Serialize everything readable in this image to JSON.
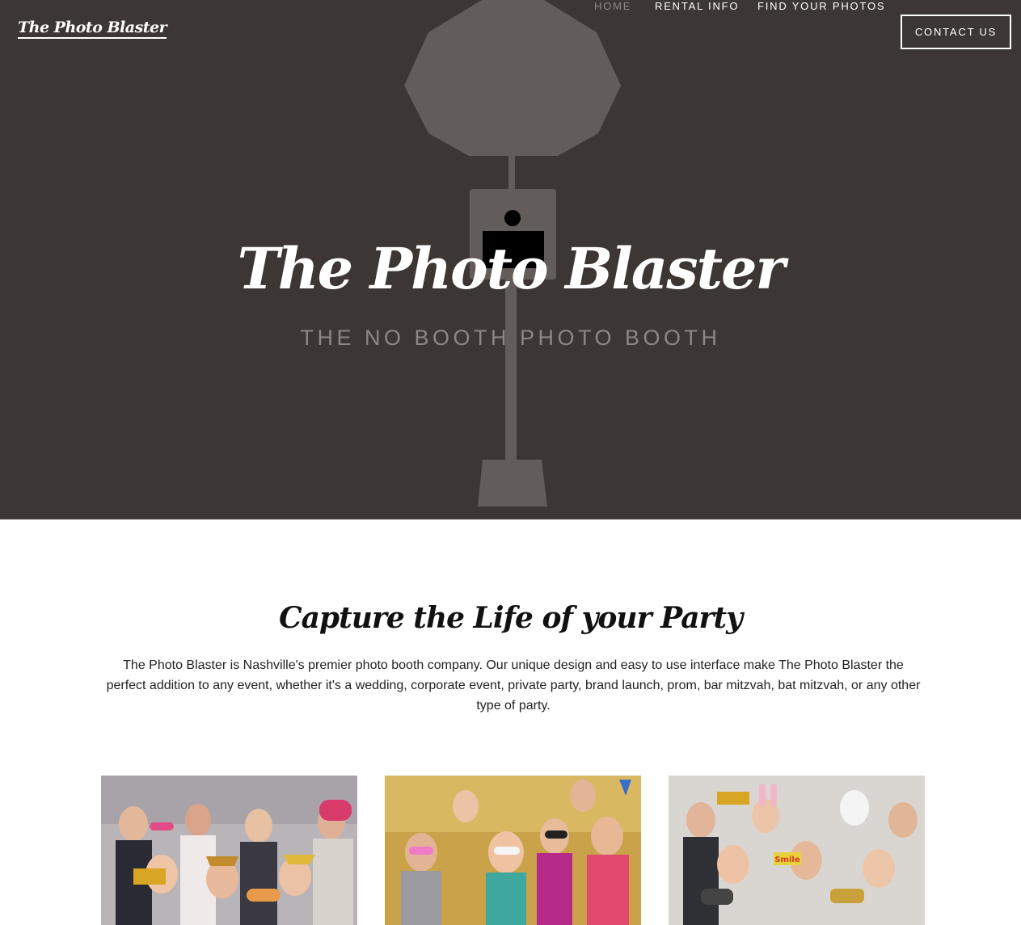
{
  "header": {
    "logo_text": "The Photo Blaster",
    "nav": [
      {
        "label": "HOME",
        "active": true
      },
      {
        "label": "RENTAL INFO",
        "active": false
      },
      {
        "label": "FIND YOUR PHOTOS",
        "active": false
      }
    ],
    "contact_label": "CONTACT US"
  },
  "hero": {
    "title": "The Photo Blaster",
    "subtitle": "THE NO BOOTH PHOTO BOOTH",
    "background_color": "#3c3734",
    "illustration_icon": "photo-booth-umbrella-icon"
  },
  "intro": {
    "heading": "Capture the Life of your Party",
    "body": "The Photo Blaster is Nashville's premier photo booth company. Our unique design and easy to use interface make The Photo Blaster the perfect addition to any event, whether it's a wedding, corporate event, private party, brand launch, prom, bar mitzvah, bat mitzvah, or any other type of party."
  },
  "gallery": [
    {
      "backdrop": "silver sequin",
      "accent": "#b9b4b8"
    },
    {
      "backdrop": "gold sequin",
      "accent": "#c9a24a"
    },
    {
      "backdrop": "white",
      "accent": "#d9d6d2",
      "prop_text": "Smile"
    }
  ]
}
